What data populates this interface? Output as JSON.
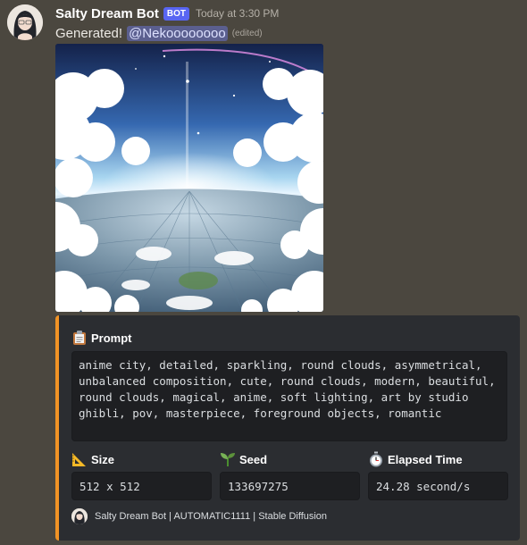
{
  "message": {
    "username": "Salty Dream Bot",
    "bot_tag": "BOT",
    "timestamp": "Today at 3:30 PM",
    "content": "Generated!",
    "mention": "@Nekoooooooo",
    "edited": "(edited)"
  },
  "image": {
    "subject": "anime city under sky with clouds"
  },
  "embed": {
    "accent_color": "#f19325",
    "fields": {
      "prompt": {
        "icon": "clipboard-icon",
        "name": "Prompt",
        "value": "anime city, detailed, sparkling, round clouds, asymmetrical, unbalanced composition, cute, round clouds, modern, beautiful, round clouds, magical, anime, soft lighting, art by studio ghibli, pov, masterpiece, foreground objects, romantic"
      },
      "size": {
        "icon": "triangular-ruler-icon",
        "name": "Size",
        "value": "512 x 512"
      },
      "seed": {
        "icon": "seedling-icon",
        "name": "Seed",
        "value": "133697275"
      },
      "elapsed": {
        "icon": "stopwatch-icon",
        "name": "Elapsed Time",
        "value": "24.28 second/s"
      }
    },
    "footer": "Salty Dream Bot | AUTOMATIC1111 | Stable Diffusion"
  },
  "colors": {
    "background": "#4b473f",
    "embed_background": "#2b2d31",
    "code_background": "#1e1f22",
    "bot_tag": "#5865f2"
  }
}
